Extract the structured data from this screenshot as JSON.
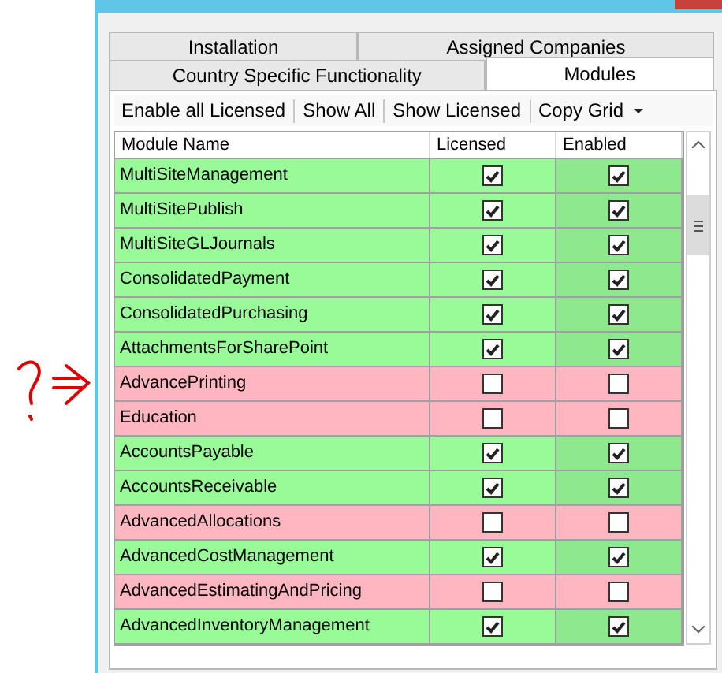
{
  "tabs_row_1": [
    {
      "label": "Installation",
      "selected": false
    },
    {
      "label": "Assigned Companies",
      "selected": false
    }
  ],
  "tabs_row_2": [
    {
      "label": "Country Specific Functionality",
      "selected": false
    },
    {
      "label": "Modules",
      "selected": true
    }
  ],
  "toolbar": [
    {
      "label": "Enable all Licensed",
      "dropdown": false
    },
    {
      "label": "Show All",
      "dropdown": false
    },
    {
      "label": "Show Licensed",
      "dropdown": false
    },
    {
      "label": "Copy Grid",
      "dropdown": true
    }
  ],
  "grid": {
    "columns": [
      "Module Name",
      "Licensed",
      "Enabled"
    ],
    "rows": [
      {
        "name": "MultiSiteManagement",
        "licensed": true,
        "enabled": true
      },
      {
        "name": "MultiSitePublish",
        "licensed": true,
        "enabled": true
      },
      {
        "name": "MultiSiteGLJournals",
        "licensed": true,
        "enabled": true
      },
      {
        "name": "ConsolidatedPayment",
        "licensed": true,
        "enabled": true
      },
      {
        "name": "ConsolidatedPurchasing",
        "licensed": true,
        "enabled": true
      },
      {
        "name": "AttachmentsForSharePoint",
        "licensed": true,
        "enabled": true
      },
      {
        "name": "AdvancePrinting",
        "licensed": false,
        "enabled": false
      },
      {
        "name": "Education",
        "licensed": false,
        "enabled": false
      },
      {
        "name": "AccountsPayable",
        "licensed": true,
        "enabled": true
      },
      {
        "name": "AccountsReceivable",
        "licensed": true,
        "enabled": true
      },
      {
        "name": "AdvancedAllocations",
        "licensed": false,
        "enabled": false
      },
      {
        "name": "AdvancedCostManagement",
        "licensed": true,
        "enabled": true
      },
      {
        "name": "AdvancedEstimatingAndPricing",
        "licensed": false,
        "enabled": false
      },
      {
        "name": "AdvancedInventoryManagement",
        "licensed": true,
        "enabled": true
      }
    ]
  }
}
